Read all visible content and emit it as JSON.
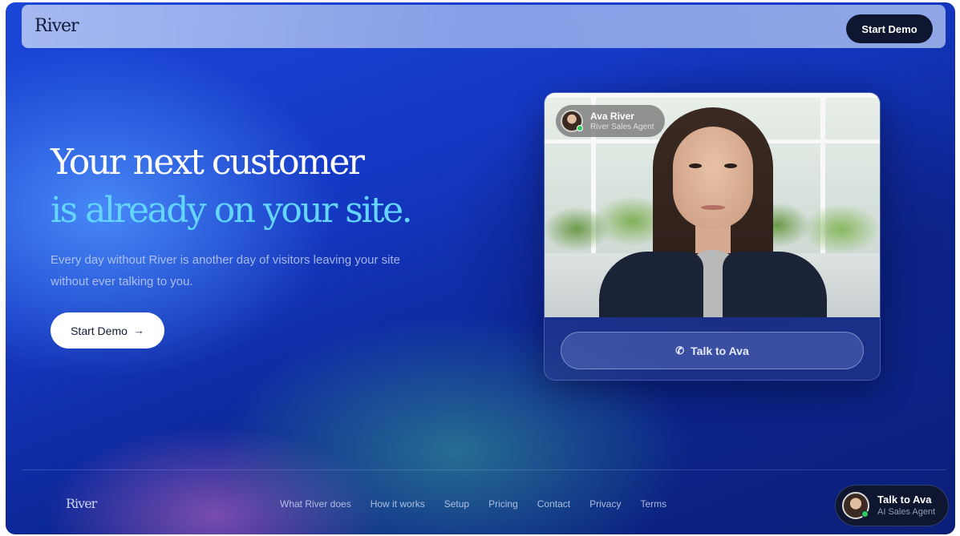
{
  "header": {
    "logo": "River",
    "cta_label": "Start Demo"
  },
  "hero": {
    "title_line1": "Your next customer",
    "title_line2": "is already on your site.",
    "subtitle": "Every day without River is another day of visitors leaving your site without ever talking to you.",
    "cta_label": "Start Demo",
    "cta_icon": "arrow-right-icon"
  },
  "video_card": {
    "agent_name": "Ava River",
    "agent_role": "River Sales Agent",
    "agent_status": "online",
    "talk_label": "Talk to Ava",
    "talk_icon": "phone-icon"
  },
  "footer": {
    "logo": "River",
    "links": [
      "What River does",
      "How it works",
      "Setup",
      "Pricing",
      "Contact",
      "Privacy",
      "Terms"
    ]
  },
  "chat_widget": {
    "title": "Talk to Ava",
    "subtitle": "AI Sales Agent",
    "status": "online"
  },
  "colors": {
    "accent_cyan": "#63d5ff",
    "dark_button": "#0f1630",
    "online_green": "#2ec95c"
  }
}
